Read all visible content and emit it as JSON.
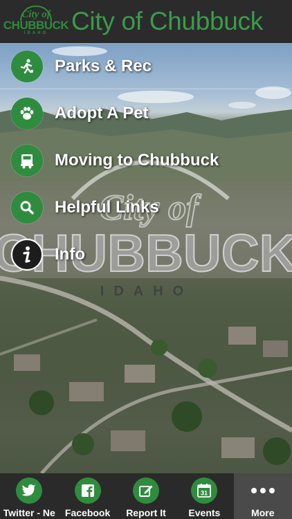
{
  "header": {
    "title": "City of Chubbuck",
    "logo": {
      "city": "City of",
      "main": "CHUBBUCK",
      "sub": "IDAHO"
    }
  },
  "background": {
    "watermark": {
      "city": "City of",
      "main": "CHUBBUCK",
      "sub": "IDAHO"
    }
  },
  "menu": {
    "items": [
      {
        "label": "Parks & Rec",
        "icon": "running-person-icon"
      },
      {
        "label": "Adopt A Pet",
        "icon": "paw-icon"
      },
      {
        "label": "Moving to Chubbuck",
        "icon": "truck-icon"
      },
      {
        "label": "Helpful Links",
        "icon": "search-icon"
      },
      {
        "label": "Info",
        "icon": "info-icon"
      }
    ]
  },
  "tabbar": {
    "tabs": [
      {
        "label": "Twitter - Ne",
        "icon": "twitter-icon"
      },
      {
        "label": "Facebook",
        "icon": "facebook-icon"
      },
      {
        "label": "Report It",
        "icon": "edit-icon"
      },
      {
        "label": "Events",
        "icon": "calendar-icon"
      },
      {
        "label": "More",
        "icon": "more-dots-icon",
        "active": true
      }
    ],
    "calendar_day": "31"
  },
  "colors": {
    "brand_green": "#2f8c3f",
    "header_bg": "#2b2b2b",
    "tabbar_bg": "#2a2a2a"
  }
}
